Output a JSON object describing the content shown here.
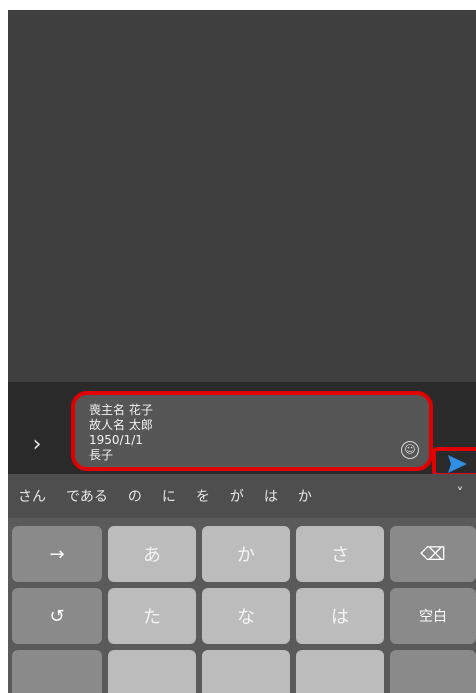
{
  "message": {
    "text": "喪主名 花子\n故人名 太郎\n1950/1/1\n長子"
  },
  "input_bar": {
    "expand_icon": "chevron-right-icon",
    "emoji_icon": "smile-icon",
    "send_icon": "send-icon"
  },
  "colors": {
    "highlight": "#e00000",
    "send": "#2f8fe8"
  },
  "suggestions": [
    "さん",
    "である",
    "の",
    "に",
    "を",
    "が",
    "は",
    "か"
  ],
  "keyboard": {
    "row1": [
      "→",
      "あ",
      "か",
      "さ",
      "⌫"
    ],
    "row2": [
      "↺",
      "た",
      "な",
      "は",
      "空白"
    ]
  }
}
